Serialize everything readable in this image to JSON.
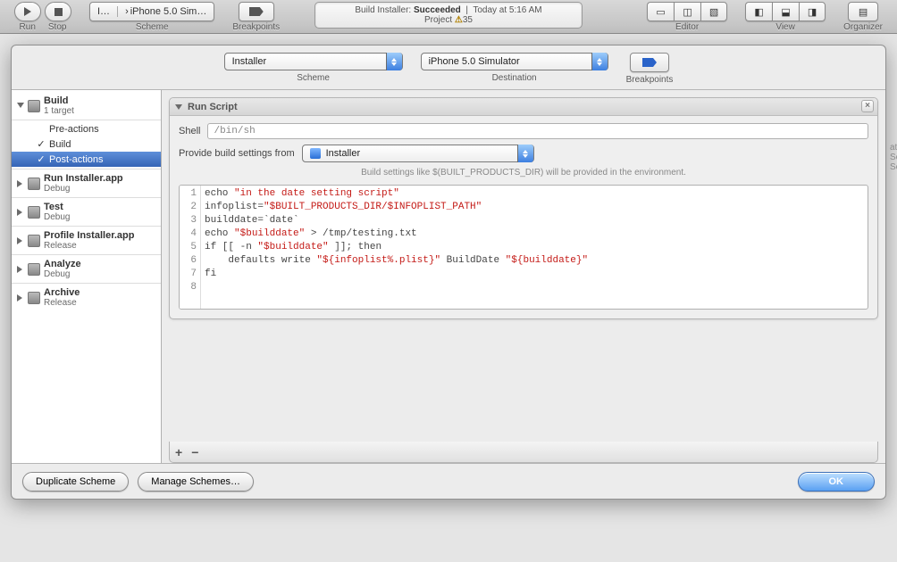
{
  "toolbar": {
    "run": "Run",
    "stop": "Stop",
    "scheme_label": "Scheme",
    "breakpoints_label": "Breakpoints",
    "scheme_name_short": "I…",
    "scheme_dest_short": "iPhone 5.0 Sim…",
    "editor_label": "Editor",
    "view_label": "View",
    "organizer_label": "Organizer"
  },
  "status": {
    "line1_prefix": "Build Installer: ",
    "line1_result": "Succeeded",
    "line1_time": "Today at 5:16 AM",
    "line2_label": "Project",
    "line2_count": "35"
  },
  "sheet": {
    "scheme_label": "Scheme",
    "scheme_value": "Installer",
    "dest_label": "Destination",
    "dest_value": "iPhone 5.0 Simulator",
    "bp_label": "Breakpoints"
  },
  "outline": [
    {
      "title": "Build",
      "sub": "1 target",
      "open": true,
      "children": [
        "Pre-actions",
        "Build",
        "Post-actions"
      ]
    },
    {
      "title": "Run Installer.app",
      "sub": "Debug"
    },
    {
      "title": "Test",
      "sub": "Debug"
    },
    {
      "title": "Profile Installer.app",
      "sub": "Release"
    },
    {
      "title": "Analyze",
      "sub": "Debug"
    },
    {
      "title": "Archive",
      "sub": "Release"
    }
  ],
  "build_checked_index": 1,
  "selected_child": "Post-actions",
  "panel": {
    "title": "Run Script",
    "shell_label": "Shell",
    "shell_value": "/bin/sh",
    "provide_label": "Provide build settings from",
    "provide_value": "Installer",
    "hint": "Build settings like $(BUILT_PRODUCTS_DIR) will be provided in the environment."
  },
  "code": {
    "line_numbers": [
      "1",
      "2",
      "3",
      "4",
      "5",
      "6",
      "7",
      "8"
    ],
    "l1a": "echo ",
    "l1b": "\"in the date setting script\"",
    "l2a": "infoplist=",
    "l2b": "\"$BUILT_PRODUCTS_DIR/$INFOPLIST_PATH\"",
    "l3": "builddate=`date`",
    "l4a": "echo ",
    "l4b": "\"$builddate\"",
    "l4c": " > /tmp/testing.txt",
    "l5a": "if [[ -n ",
    "l5b": "\"$builddate\"",
    "l5c": " ]]; then",
    "l6a": "    defaults write ",
    "l6b": "\"${infoplist%.plist}\"",
    "l6c": " BuildDate ",
    "l6d": "\"${builddate}\"",
    "l7": "fi",
    "l8": ""
  },
  "buttons": {
    "dup": "Duplicate Scheme",
    "manage": "Manage Schemes…",
    "ok": "OK",
    "plus": "+",
    "minus": "−"
  }
}
